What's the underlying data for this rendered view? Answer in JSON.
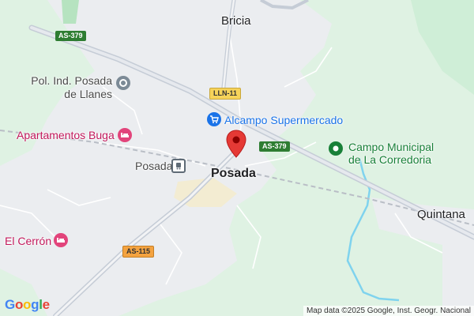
{
  "map": {
    "places": {
      "bricia": "Bricia",
      "posada": "Posada",
      "quintana": "Quintana"
    },
    "pois": {
      "industrial_line1": "Pol. Ind. Posada",
      "industrial_line2": "de Llanes",
      "apartamentos": "Apartamentos Buga",
      "alcampo": "Alcampo Supermercado",
      "campo_line1": "Campo Municipal",
      "campo_line2": "de La Corredoria",
      "cerron": "El Cerrón",
      "station": "Posada"
    },
    "roads": {
      "as379_top": "AS-379",
      "as379_right": "AS-379",
      "lln11": "LLN-11",
      "as115": "AS-115"
    },
    "attribution": "Map data ©2025 Google, Inst. Geogr. Nacional",
    "logo": "Google",
    "colors": {
      "land": "#dff2e3",
      "urban": "#ebedf0",
      "water": "#7fd3ee",
      "pin": "#e53935"
    },
    "icons": {
      "industrial": "industrial-icon",
      "hotel": "hotel-icon",
      "shopping": "shopping-cart-icon",
      "sports": "sports-field-icon",
      "station": "train-station-icon",
      "pin": "location-pin-icon"
    }
  }
}
